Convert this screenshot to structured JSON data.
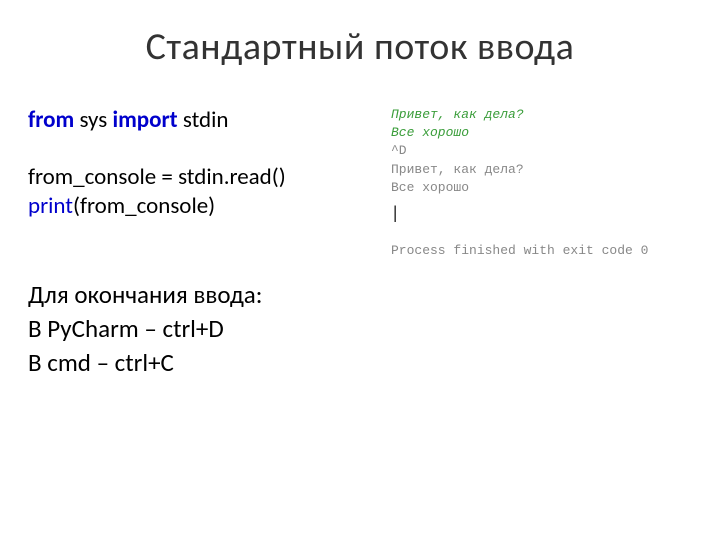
{
  "title": "Стандартный поток ввода",
  "code": {
    "line1_from": "from",
    "line1_sys": " sys ",
    "line1_import": "import",
    "line1_stdin": " stdin",
    "line2": "from_console = stdin.read()",
    "line3_print": "print",
    "line3_rest": "(from_console)"
  },
  "notes": {
    "h": "Для окончания ввода:",
    "pycharm": "В PyCharm – ctrl+D",
    "cmd": "В cmd – ctrl+C"
  },
  "console": {
    "in1": "Привет, как дела?",
    "in2": "Все хорошо",
    "ctrl": "^D",
    "out1": "Привет, как дела?",
    "out2": "Все хорошо",
    "cursor": "|",
    "process": "Process finished with exit code 0"
  }
}
